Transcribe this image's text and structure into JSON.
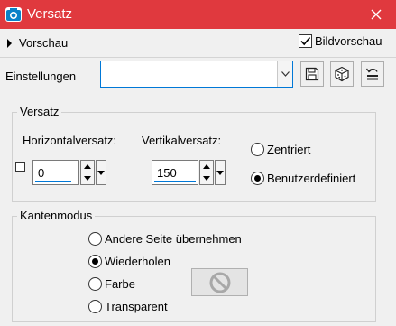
{
  "window": {
    "title": "Versatz",
    "titlebar_color": "#e0393e"
  },
  "preview": {
    "toggle_label": "Vorschau",
    "image_preview_label": "Bildvorschau",
    "image_preview_checked": true
  },
  "settings": {
    "label": "Einstellungen",
    "preset_value": "",
    "buttons": [
      {
        "name": "save-preset-button",
        "icon": "floppy-disk-icon"
      },
      {
        "name": "random-button",
        "icon": "dice-icon"
      },
      {
        "name": "reset-button",
        "icon": "reset-icon"
      }
    ]
  },
  "offset_group": {
    "title": "Versatz",
    "horizontal_label": "Horizontalversatz:",
    "horizontal_value": "0",
    "vertical_label": "Vertikalversatz:",
    "vertical_value": "150",
    "link_checked": false,
    "mode_options": [
      "Zentriert",
      "Benutzerdefiniert"
    ],
    "mode_selected": "Benutzerdefiniert"
  },
  "edge_group": {
    "title": "Kantenmodus",
    "options": [
      "Andere Seite übernehmen",
      "Wiederholen",
      "Farbe",
      "Transparent"
    ],
    "selected": "Wiederholen",
    "color_well_icon": "no-sign-icon"
  }
}
